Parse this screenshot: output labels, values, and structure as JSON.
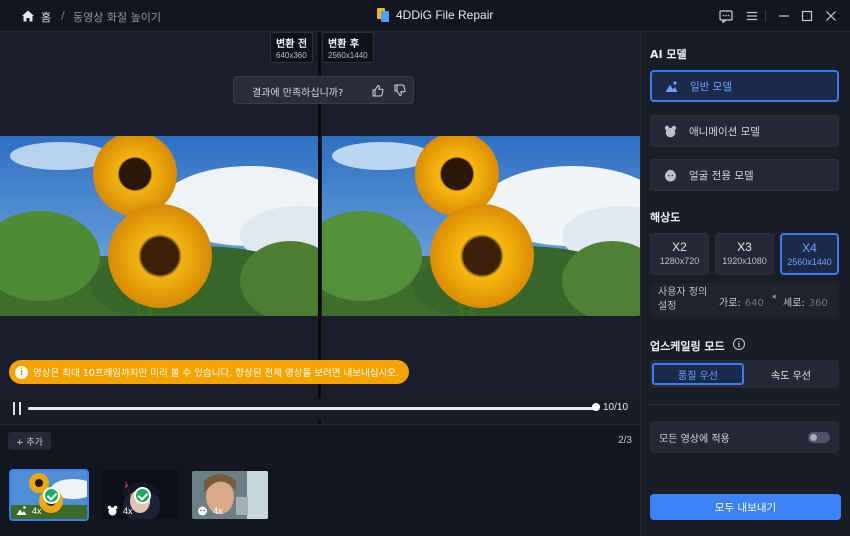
{
  "titlebar": {
    "home_label": "홈",
    "separator": "/",
    "breadcrumb": "동영상 화질 높이기",
    "app_title": "4DDiG File Repair"
  },
  "preview": {
    "before": {
      "label": "변환 전",
      "resolution": "640x360"
    },
    "after": {
      "label": "변환 후",
      "resolution": "2560x1440"
    },
    "feedback_question": "결과에 만족하십니까?",
    "notice": "영상은 최대 10프레임까지만 미리 볼 수 있습니다. 향상된 전체 영상을 보려면 내보내십시오.",
    "progress": {
      "current": 10,
      "total": 10,
      "label": "10/10",
      "fraction": 1.0
    }
  },
  "strip": {
    "add_label": "+ 추가",
    "count": "2/3",
    "thumbnails": [
      {
        "scale": "4x",
        "mode_icon": "landscape-icon",
        "checked": true,
        "active": true
      },
      {
        "scale": "4x",
        "mode_icon": "bear-icon",
        "checked": true,
        "active": false
      },
      {
        "scale": "4x",
        "mode_icon": "face-icon",
        "checked": false,
        "active": false
      }
    ]
  },
  "panel": {
    "ai_model_title": "AI 모델",
    "models": [
      {
        "label": "일반 모델",
        "icon": "landscape-icon",
        "active": true
      },
      {
        "label": "애니메이션 모델",
        "icon": "bear-icon",
        "active": false
      },
      {
        "label": "얼굴 전용 모델",
        "icon": "face-icon",
        "active": false
      }
    ],
    "resolution_title": "해상도",
    "resolutions": [
      {
        "label": "X2",
        "size": "1280x720",
        "active": false
      },
      {
        "label": "X3",
        "size": "1920x1080",
        "active": false
      },
      {
        "label": "X4",
        "size": "2560x1440",
        "active": true
      }
    ],
    "custom": {
      "label": "사용자 정의 설정",
      "width_label": "가로:",
      "width_value": "640",
      "times": "*",
      "height_label": "세로:",
      "height_value": "360"
    },
    "upscale_title": "업스케일링 모드",
    "upscale_options": [
      {
        "label": "품질 우선",
        "active": true
      },
      {
        "label": "속도 우선",
        "active": false
      }
    ],
    "apply_all_label": "모든 영상에 적용",
    "apply_all_on": false,
    "export_label": "모두 내보내기"
  },
  "colors": {
    "accent": "#3b82f6",
    "notice": "#f5a300",
    "check": "#1ea85a"
  }
}
